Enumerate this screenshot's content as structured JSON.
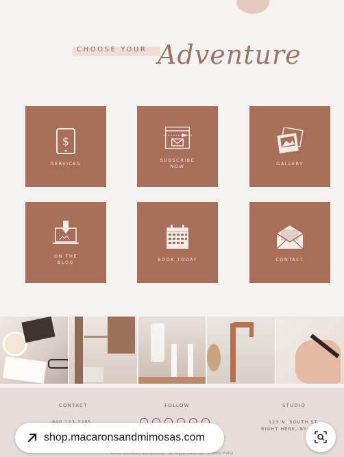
{
  "header": {
    "eyebrow": "CHOOSE YOUR",
    "script_title": "Adventure"
  },
  "tiles": [
    {
      "label": "SERVICES",
      "icon": "tablet-dollar-icon"
    },
    {
      "label": "SUBSCRIBE\nNOW",
      "icon": "email-subscribe-icon"
    },
    {
      "label": "GALLERY",
      "icon": "photos-icon"
    },
    {
      "label": "ON THE\nBLOG",
      "icon": "laptop-blog-icon"
    },
    {
      "label": "BOOK TODAY",
      "icon": "calendar-icon"
    },
    {
      "label": "CONTACT",
      "icon": "envelope-icon"
    }
  ],
  "photos": [
    "coffee-magazine-photo",
    "jewelry-shelf-photo",
    "glassware-shelf-photo",
    "copper-faucet-photo",
    "hand-writing-photo"
  ],
  "footer": {
    "contact_heading": "CONTACT",
    "contact_phone": "800.123.2285",
    "follow_heading": "FOLLOW",
    "studio_heading": "STUDIO",
    "studio_line1": "123 N. SOUTH ST.",
    "studio_line2": "RIGHT HERE, NY",
    "copyright": "©2018 Macarons and Mimosas  ·  All Rights Reserved  ·  Privacy Policy"
  },
  "overlay": {
    "url": "shop.macaronsandmimosas.com"
  },
  "colors": {
    "tile": "#a76e58",
    "background": "#f5f3f1",
    "footer": "#e6dcd9"
  }
}
